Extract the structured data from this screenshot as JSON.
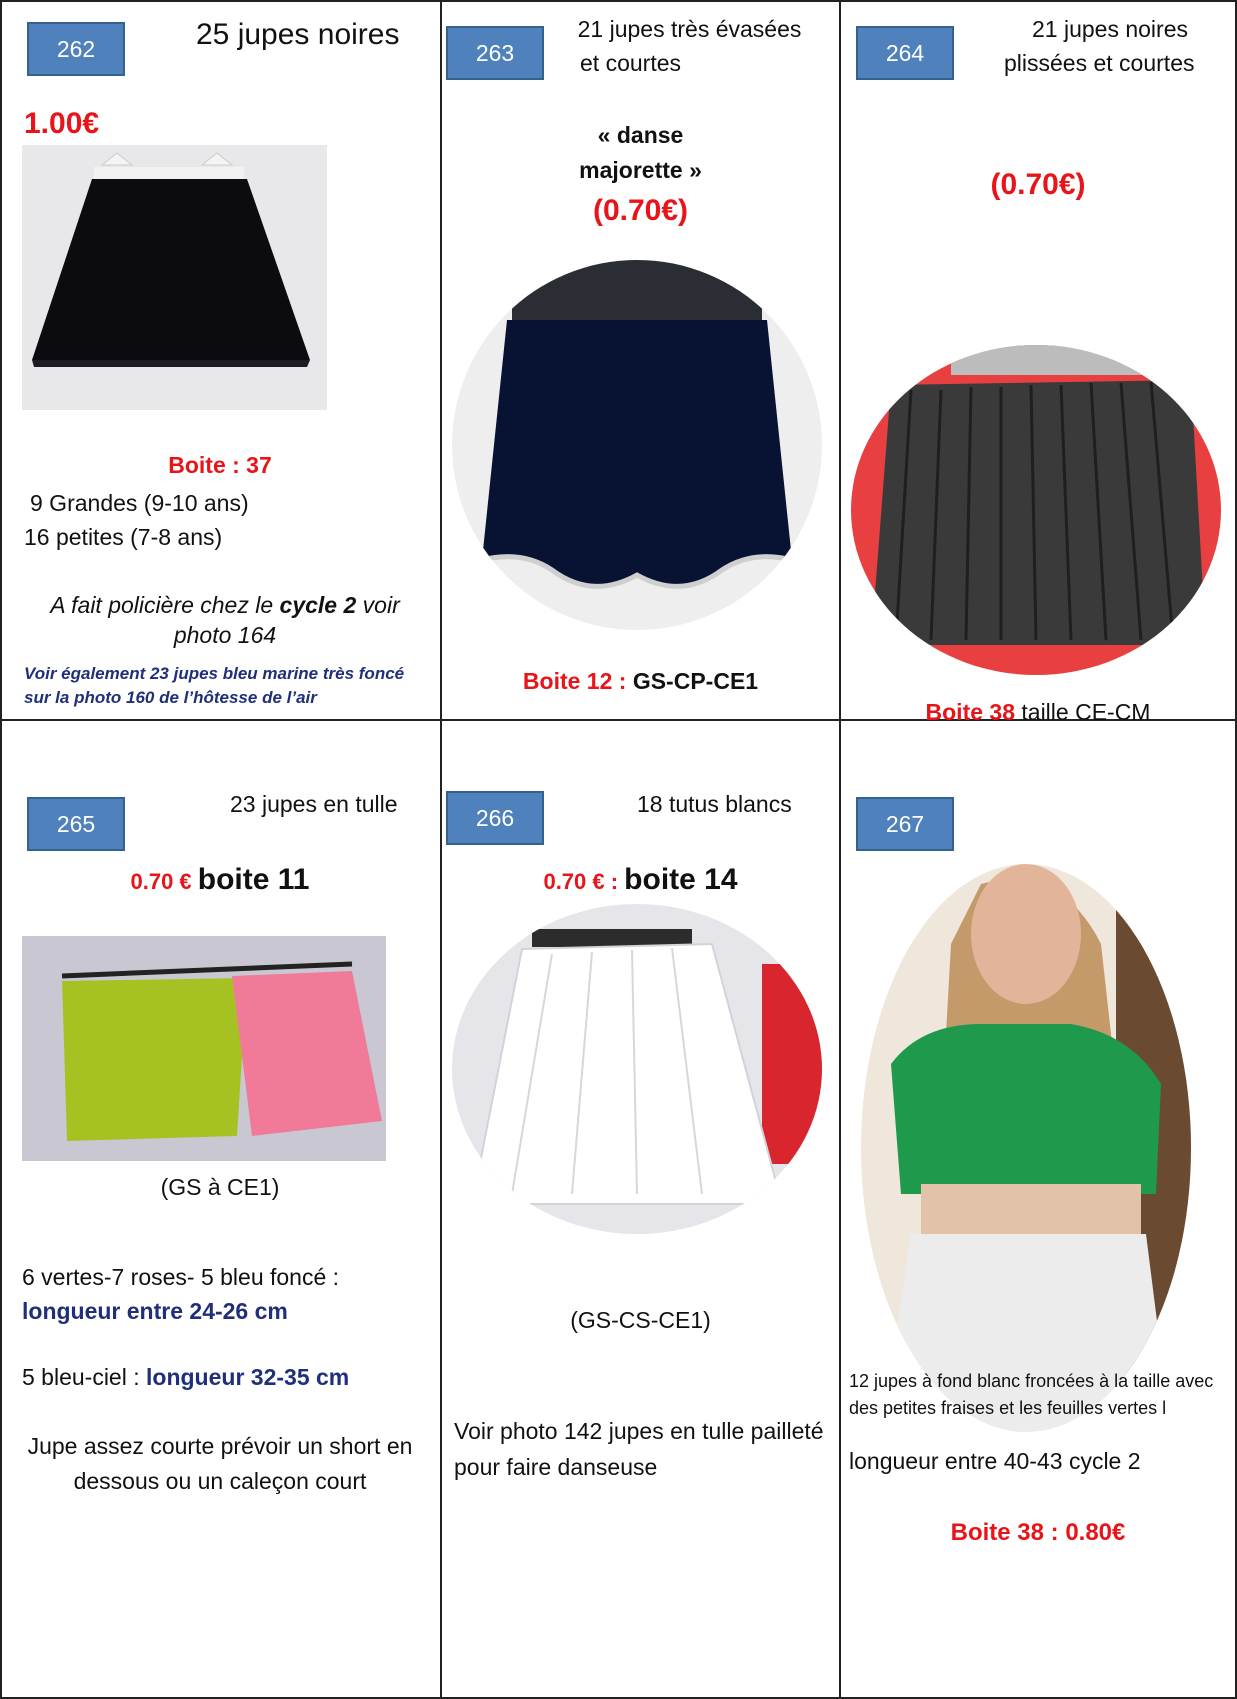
{
  "items": [
    {
      "number": "262",
      "title": "25 jupes noires",
      "price": "1.00€",
      "box": "Boite : 37",
      "line1": "9 Grandes (9-10 ans)",
      "line2": "16 petites (7-8 ans)",
      "note_a": "A fait policière chez le ",
      "note_b": "cycle 2",
      "note_c": " voir photo 164",
      "note_small": "Voir également 23 jupes bleu marine très foncé sur la photo 160 de l’hôtesse de l’air",
      "photo_icon": "black-skirt-photo"
    },
    {
      "number": "263",
      "title_l1": "21 jupes très évasées",
      "title_l2": "et courtes",
      "sub_l1": "« danse",
      "sub_l2": "majorette »",
      "price": "(0.70€)",
      "box_label": "Boite 12 : ",
      "box_value": "GS-CP-CE1",
      "photo_icon": "navy-flared-skirt-photo"
    },
    {
      "number": "264",
      "title_l1": "21 jupes  noires",
      "title_l2": "plissées et courtes",
      "price": "(0.70€)",
      "box_label": "Boite 38",
      "box_value": " taille CE-CM",
      "photo_icon": "pleated-skirt-photo"
    },
    {
      "number": "265",
      "title": "23 jupes en tulle",
      "price": "0.70 € ",
      "box": "boite 11",
      "grade": "(GS à CE1)",
      "colors": "6 vertes-7 roses- 5 bleu foncé :",
      "length1": "longueur entre 24-26 cm",
      "sky_label": "5 bleu-ciel : ",
      "length2": "longueur  32-35 cm",
      "advice": "Jupe assez courte prévoir un short en dessous ou un caleçon court",
      "photo_icon": "tulle-skirts-photo"
    },
    {
      "number": "266",
      "title": "18 tutus blancs",
      "price": "0.70 € : ",
      "box": "boite 14",
      "grade": "(GS-CS-CE1)",
      "note": "Voir photo 142 jupes en tulle pailleté pour faire danseuse",
      "photo_icon": "white-tutu-photo"
    },
    {
      "number": "267",
      "desc": "12 jupes à fond blanc froncées à la taille  avec des petites fraises et les feuilles vertes l",
      "length": "longueur entre 40-43 cycle 2",
      "box": "Boite 38 :   0.80€",
      "photo_icon": "child-wearing-skirt-photo"
    }
  ],
  "colors": {
    "badge": "#4f81bd",
    "accent_red": "#e8141a",
    "navy": "#1f2f7a",
    "border": "#222222"
  }
}
